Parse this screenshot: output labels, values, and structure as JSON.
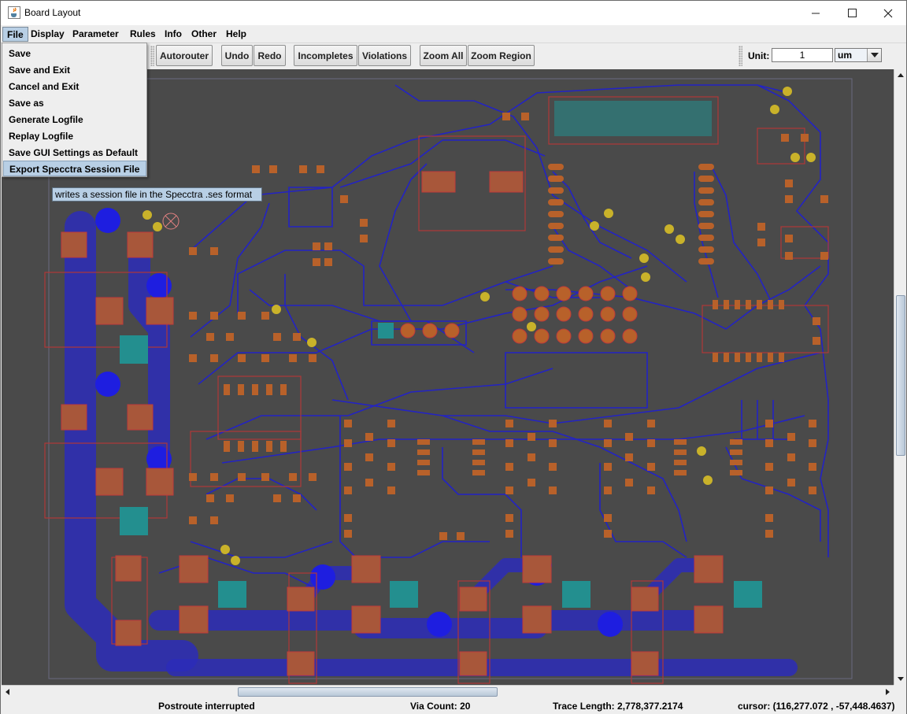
{
  "window": {
    "title": "Board Layout",
    "icon": "java-cup-icon"
  },
  "menubar": [
    {
      "label": "File",
      "active": true
    },
    {
      "label": "Display"
    },
    {
      "label": "Parameter"
    },
    {
      "label": "Rules"
    },
    {
      "label": "Info"
    },
    {
      "label": "Other"
    },
    {
      "label": "Help"
    }
  ],
  "file_menu": [
    "Save",
    "Save and Exit",
    "Cancel and Exit",
    "Save as",
    "Generate Logfile",
    "Replay Logfile",
    "Save GUI Settings as Default",
    "Export Specctra Session File"
  ],
  "tooltip": "writes a session file in the Specctra .ses format",
  "toolbar": {
    "autorouter": "Autorouter",
    "undo": "Undo",
    "redo": "Redo",
    "incompletes": "Incompletes",
    "violations": "Violations",
    "zoom_all": "Zoom All",
    "zoom_region": "Zoom Region",
    "unit_label": "Unit:",
    "unit_value": "1",
    "unit_select": "um"
  },
  "status": {
    "message": "Postroute interrupted",
    "via_count": "Via Count: 20",
    "trace_length": "Trace Length: 2,778,377.2174",
    "cursor": "cursor:  (116,277.072 , -57,448.4637)"
  },
  "colors": {
    "board_bg": "#4a4a4a",
    "trace": "#2222cc",
    "pad": "#b8612a",
    "outline": "#c03a3a",
    "via": "#c9b22a",
    "smd_cyan": "#238f8f"
  }
}
